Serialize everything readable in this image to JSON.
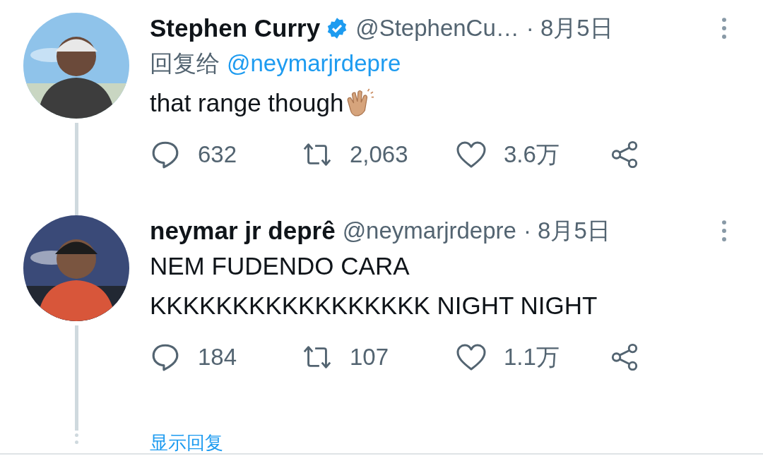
{
  "tweets": [
    {
      "author": "Stephen Curry",
      "verified": true,
      "handle": "@StephenCu…",
      "date": "· 8月5日",
      "reply_to_label": "回复给",
      "reply_to_handle": "@neymarjrdepre",
      "lines": [
        "that range though"
      ],
      "emoji_after_text": true,
      "replies": "632",
      "retweets": "2,063",
      "likes": "3.6万"
    },
    {
      "author": "neymar jr deprê",
      "verified": false,
      "handle": "@neymarjrdepre",
      "date": "· 8月5日",
      "lines": [
        "NEM FUDENDO CARA",
        "KKKKKKKKKKKKKKKKK NIGHT NIGHT"
      ],
      "replies": "184",
      "retweets": "107",
      "likes": "1.1万"
    }
  ],
  "show_replies": "显示回复"
}
